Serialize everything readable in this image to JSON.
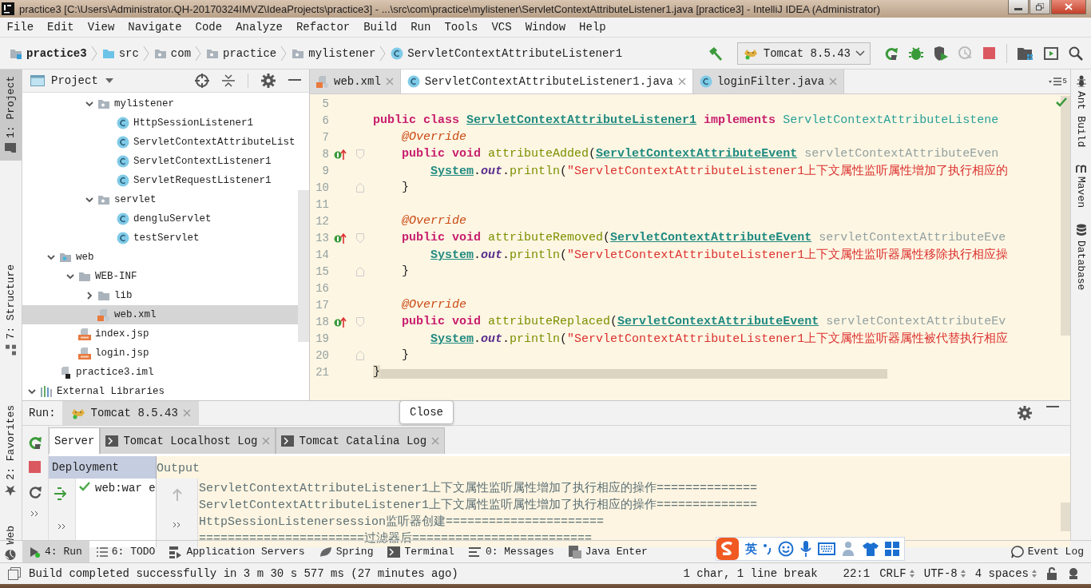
{
  "window": {
    "title": "practice3 [C:\\Users\\Administrator.QH-20170324IMVZ\\IdeaProjects\\practice3] - ...\\src\\com\\practice\\mylistener\\ServletContextAttributeListener1.java [practice3] - IntelliJ IDEA (Administrator)"
  },
  "menu": [
    "File",
    "Edit",
    "View",
    "Navigate",
    "Code",
    "Analyze",
    "Refactor",
    "Build",
    "Run",
    "Tools",
    "VCS",
    "Window",
    "Help"
  ],
  "breadcrumbs": [
    {
      "label": "practice3",
      "kind": "project"
    },
    {
      "label": "src",
      "kind": "source"
    },
    {
      "label": "com",
      "kind": "package"
    },
    {
      "label": "practice",
      "kind": "package"
    },
    {
      "label": "mylistener",
      "kind": "package"
    },
    {
      "label": "ServletContextAttributeListener1",
      "kind": "class"
    }
  ],
  "run_config": {
    "label": "Tomcat 8.5.43"
  },
  "left_stripe": [
    {
      "label": "1: Project",
      "kind": "project",
      "selected": true
    },
    {
      "label": "7: Structure",
      "kind": "structure",
      "selected": false
    },
    {
      "label": "2: Favorites",
      "kind": "favorites",
      "selected": false
    },
    {
      "label": "Web",
      "kind": "web",
      "selected": false
    }
  ],
  "right_stripe": [
    {
      "label": "Ant Build",
      "kind": "ant"
    },
    {
      "label": "Maven",
      "kind": "maven"
    },
    {
      "label": "Database",
      "kind": "database"
    }
  ],
  "project_panel": {
    "title": "Project",
    "groups": [
      {
        "rows": [
          {
            "label": "mylistener",
            "kind": "package",
            "expanded": true,
            "selected": false,
            "children": [
              {
                "label": "HttpSessionListener1",
                "kind": "class",
                "selected": false
              },
              {
                "label": "ServletContextAttributeList",
                "kind": "class",
                "selected": false
              },
              {
                "label": "ServletContextListener1",
                "kind": "class",
                "selected": false
              },
              {
                "label": "ServletRequestListener1",
                "kind": "class",
                "selected": false
              }
            ]
          },
          {
            "label": "servlet",
            "kind": "package",
            "expanded": true,
            "selected": false,
            "children": [
              {
                "label": "dengluServlet",
                "kind": "class",
                "selected": false
              },
              {
                "label": "testServlet",
                "kind": "class",
                "selected": false
              }
            ]
          }
        ]
      },
      {
        "rows": [
          {
            "label": "web",
            "kind": "web",
            "expanded": true,
            "selected": false,
            "children": [
              {
                "label": "WEB-INF",
                "kind": "folder",
                "expanded": true,
                "selected": false,
                "children": [
                  {
                    "label": "lib",
                    "kind": "folder",
                    "expanded": false,
                    "selected": false
                  },
                  {
                    "label": "web.xml",
                    "kind": "xml",
                    "selected": true
                  }
                ]
              },
              {
                "label": "index.jsp",
                "kind": "jsp",
                "selected": false
              },
              {
                "label": "login.jsp",
                "kind": "jsp",
                "selected": false
              }
            ]
          },
          {
            "label": "practice3.iml",
            "kind": "iml",
            "selected": false
          }
        ]
      },
      {
        "rows": [
          {
            "label": "External Libraries",
            "kind": "libraries",
            "expanded": true,
            "selected": false
          }
        ]
      }
    ]
  },
  "editor_tabs": [
    {
      "label": "web.xml",
      "kind": "xml",
      "selected": false
    },
    {
      "label": "ServletContextAttributeListener1.java",
      "kind": "class",
      "selected": true
    },
    {
      "label": "loginFilter.java",
      "kind": "class",
      "selected": false
    }
  ],
  "tab_overflow_count": "5",
  "code_lines": [
    {
      "number": "5"
    },
    {
      "number": "6",
      "segments": [
        {
          "kind": "kw",
          "text": "public class "
        },
        {
          "kind": "cls",
          "text": "ServletContextAttributeListener1"
        },
        {
          "kind": "kw",
          "text": " implements "
        },
        {
          "kind": "iface",
          "text": "ServletContextAttributeListene"
        }
      ]
    },
    {
      "number": "7",
      "segments": [
        {
          "kind": "ann",
          "text": "    @Override"
        }
      ]
    },
    {
      "number": "8",
      "marker": true,
      "fold_start": true,
      "segments": [
        {
          "kind": "kw",
          "text": "    public void "
        },
        {
          "kind": "method",
          "text": "attributeAdded"
        },
        {
          "kind": "p",
          "text": "("
        },
        {
          "kind": "cls",
          "text": "ServletContextAttributeEvent"
        },
        {
          "kind": "param",
          "text": " servletContextAttributeEven"
        }
      ]
    },
    {
      "number": "9",
      "segments": [
        {
          "kind": "cls",
          "text": "        System"
        },
        {
          "kind": "p",
          "text": "."
        },
        {
          "kind": "field",
          "text": "out"
        },
        {
          "kind": "p",
          "text": "."
        },
        {
          "kind": "method",
          "text": "println"
        },
        {
          "kind": "p",
          "text": "("
        },
        {
          "kind": "str",
          "text": "\"ServletContextAttributeListener1上下文属性监听属性增加了执行相应的"
        }
      ]
    },
    {
      "number": "10",
      "fold_end": true,
      "segments": [
        {
          "kind": "p",
          "text": "    }"
        }
      ]
    },
    {
      "number": "11"
    },
    {
      "number": "12",
      "segments": [
        {
          "kind": "ann",
          "text": "    @Override"
        }
      ]
    },
    {
      "number": "13",
      "marker": true,
      "fold_start": true,
      "segments": [
        {
          "kind": "kw",
          "text": "    public void "
        },
        {
          "kind": "method",
          "text": "attributeRemoved"
        },
        {
          "kind": "p",
          "text": "("
        },
        {
          "kind": "cls",
          "text": "ServletContextAttributeEvent"
        },
        {
          "kind": "param",
          "text": " servletContextAttributeEve"
        }
      ]
    },
    {
      "number": "14",
      "segments": [
        {
          "kind": "cls",
          "text": "        System"
        },
        {
          "kind": "p",
          "text": "."
        },
        {
          "kind": "field",
          "text": "out"
        },
        {
          "kind": "p",
          "text": "."
        },
        {
          "kind": "method",
          "text": "println"
        },
        {
          "kind": "p",
          "text": "("
        },
        {
          "kind": "str",
          "text": "\"ServletContextAttributeListener1上下文属性监听器属性移除执行相应操"
        }
      ]
    },
    {
      "number": "15",
      "fold_end": true,
      "segments": [
        {
          "kind": "p",
          "text": "    }"
        }
      ]
    },
    {
      "number": "16"
    },
    {
      "number": "17",
      "segments": [
        {
          "kind": "ann",
          "text": "    @Override"
        }
      ]
    },
    {
      "number": "18",
      "marker": true,
      "fold_start": true,
      "segments": [
        {
          "kind": "kw",
          "text": "    public void "
        },
        {
          "kind": "method",
          "text": "attributeReplaced"
        },
        {
          "kind": "p",
          "text": "("
        },
        {
          "kind": "cls",
          "text": "ServletContextAttributeEvent"
        },
        {
          "kind": "param",
          "text": " servletContextAttributeEv"
        }
      ]
    },
    {
      "number": "19",
      "segments": [
        {
          "kind": "cls",
          "text": "        System"
        },
        {
          "kind": "p",
          "text": "."
        },
        {
          "kind": "field",
          "text": "out"
        },
        {
          "kind": "p",
          "text": "."
        },
        {
          "kind": "method",
          "text": "println"
        },
        {
          "kind": "p",
          "text": "("
        },
        {
          "kind": "str",
          "text": "\"ServletContextAttributeListener1上下文属性监听器属性被代替执行相应"
        }
      ]
    },
    {
      "number": "20",
      "fold_end": true,
      "segments": [
        {
          "kind": "p",
          "text": "    }"
        }
      ]
    },
    {
      "number": "21",
      "segments": [
        {
          "kind": "brace",
          "text": "}"
        }
      ]
    }
  ],
  "run_panel": {
    "label": "Run:",
    "tab": "Tomcat 8.5.43",
    "server_tabs": [
      {
        "label": "Server",
        "kind": "server",
        "selected": true
      },
      {
        "label": "Tomcat Localhost Log",
        "kind": "log",
        "selected": false
      },
      {
        "label": "Tomcat Catalina Log",
        "kind": "log",
        "selected": false
      }
    ],
    "tooltip": "Close",
    "deployment_header": "Deployment",
    "output_header": "Output",
    "deployments": [
      {
        "label": "web:war e",
        "deployed": true
      }
    ],
    "output_lines": [
      "ServletContextAttributeListener1上下文属性监听属性增加了执行相应的操作==============",
      "ServletContextAttributeListener1上下文属性监听属性增加了执行相应的操作==============",
      "HttpSessionListenersession监听器创建======================",
      "=======================过滤器后========================="
    ]
  },
  "tool_buttons": [
    {
      "label": "4: Run",
      "kind": "run",
      "selected": true
    },
    {
      "label": "6: TODO",
      "kind": "todo",
      "selected": false
    },
    {
      "label": "Application Servers",
      "kind": "servers",
      "selected": false
    },
    {
      "label": "Spring",
      "kind": "spring",
      "selected": false
    },
    {
      "label": "Terminal",
      "kind": "terminal",
      "selected": false
    },
    {
      "label": "0: Messages",
      "kind": "messages",
      "selected": false
    },
    {
      "label": "Java Enter",
      "kind": "javaee",
      "selected": false
    }
  ],
  "event_log": "Event Log",
  "ime_bar": {
    "language": "英"
  },
  "status_bar": {
    "message": "Build completed successfully in 3 m 30 s 577 ms (27 minutes ago)",
    "selection": "1 char, 1 line break",
    "position": "22:1",
    "line_separator": "CRLF",
    "encoding": "UTF-8",
    "indent": "4 spaces"
  }
}
